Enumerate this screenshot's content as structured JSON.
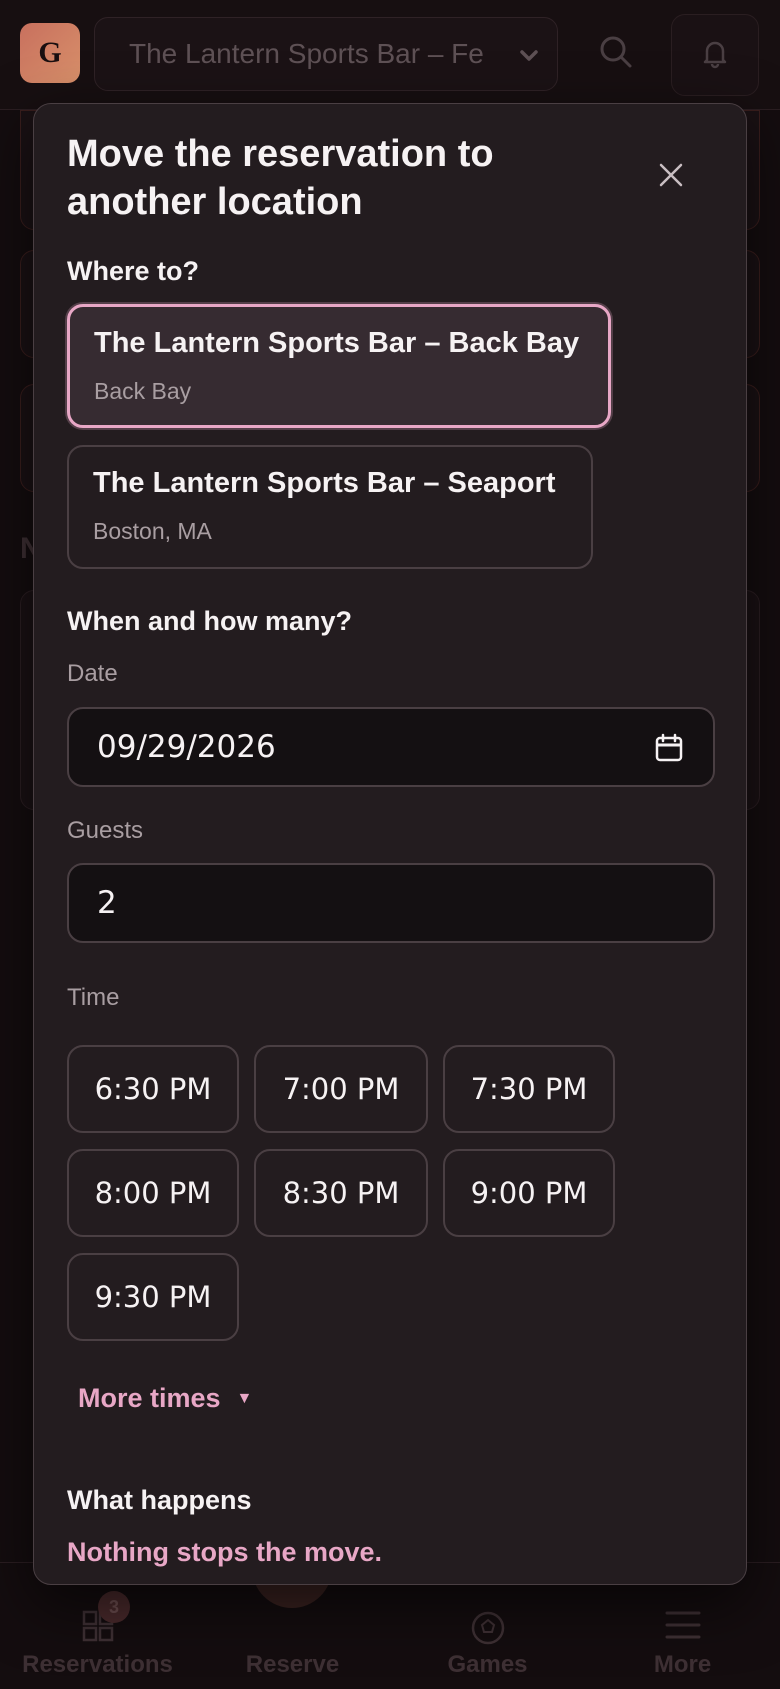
{
  "header": {
    "logo_letter": "G",
    "venue_select_value": "The Lantern Sports Bar – Fe"
  },
  "background": {
    "section_letter": "N"
  },
  "bottom_nav": {
    "reservations_label": "Reservations",
    "reservations_badge": "3",
    "reserve_label": "Reserve",
    "games_label": "Games",
    "more_label": "More"
  },
  "modal": {
    "title": "Move the reservation to another location",
    "where_title": "Where to?",
    "locations": [
      {
        "name": "The Lantern Sports Bar – Back Bay",
        "sub": "Back Bay",
        "selected": true
      },
      {
        "name": "The Lantern Sports Bar – Seaport",
        "sub": "Boston, MA",
        "selected": false
      }
    ],
    "when_title": "When and how many?",
    "date_label": "Date",
    "date_value": "09/29/2026",
    "guests_label": "Guests",
    "guests_value": "2",
    "time_label": "Time",
    "times": [
      "6:30 PM",
      "7:00 PM",
      "7:30 PM",
      "8:00 PM",
      "8:30 PM",
      "9:00 PM",
      "9:30 PM"
    ],
    "more_times_label": "More times",
    "what_happens_title": "What happens",
    "what_happens_text": "Nothing stops the move."
  },
  "colors": {
    "accent": "#e8a7c6",
    "modal_bg": "#231c1f",
    "page_bg": "#140d0f"
  },
  "icons": {
    "close": "close-icon",
    "calendar": "calendar-icon",
    "search": "search-icon",
    "bell": "bell-icon",
    "dropdown": "chevron-down-icon"
  }
}
